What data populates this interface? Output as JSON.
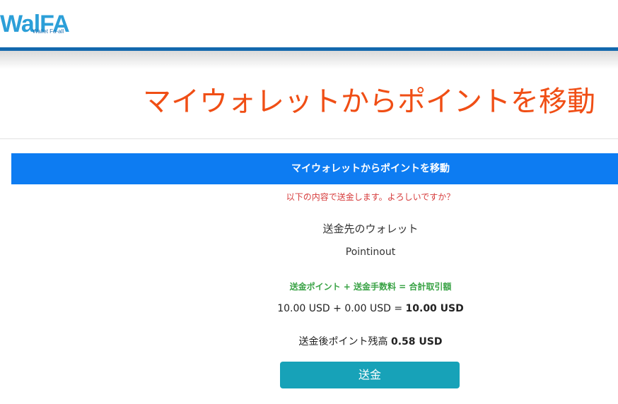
{
  "header": {
    "logo_text": "WalFA",
    "logo_sub": "Wallet Fa-all"
  },
  "page": {
    "title": "マイウォレットからポイントを移動"
  },
  "card": {
    "header_title": "マイウォレットからポイントを移動",
    "confirm_message": "以下の内容で送金します。よろしいですか？",
    "destination_label": "送金先のウォレット",
    "destination_value": "Pointinout",
    "formula_label": "送金ポイント + 送金手数料 = 合計取引額",
    "amount": "10.00 USD",
    "plus": "+",
    "fee": "0.00 USD",
    "equals": "=",
    "total": "10.00 USD",
    "balance_label": "送金後ポイント残高",
    "balance_value": "0.58 USD",
    "send_label": "送金"
  },
  "colors": {
    "title": "#f04e15",
    "card_header": "#0d7cf2",
    "confirm": "#d63a3a",
    "formula_label": "#3aa346",
    "send_button": "#17a2b8",
    "header_bar": "#1368ad"
  }
}
